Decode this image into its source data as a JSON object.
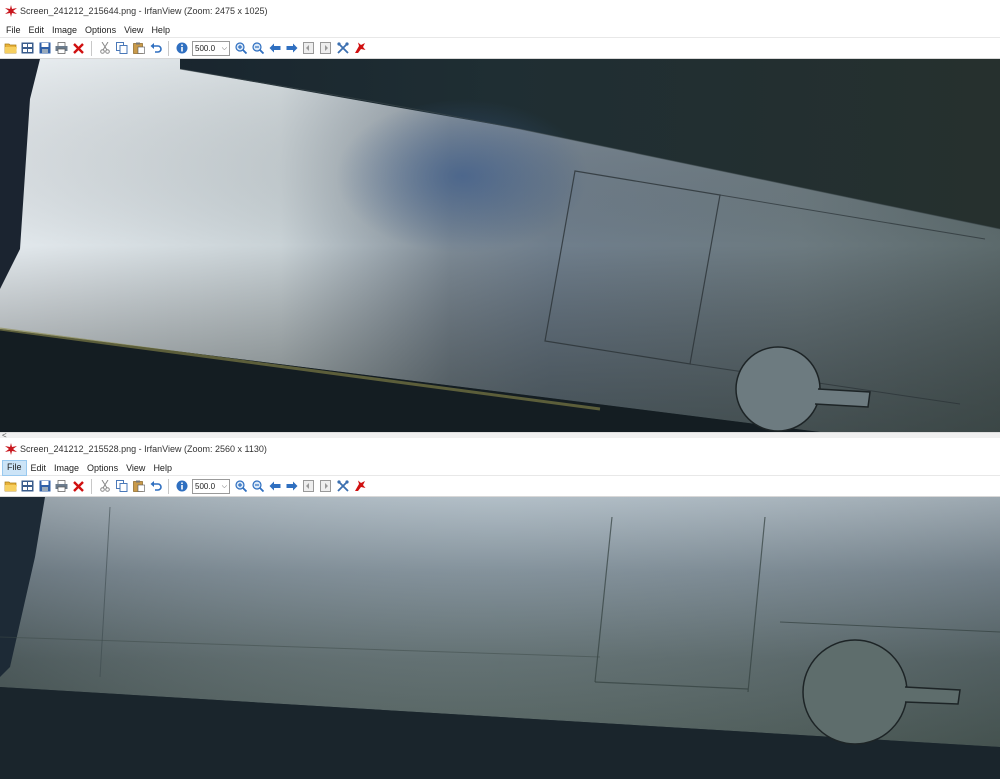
{
  "windows": [
    {
      "title": "Screen_241212_215644.png - IrfanView (Zoom: 2475 x 1025)",
      "menu": [
        "File",
        "Edit",
        "Image",
        "Options",
        "View",
        "Help"
      ],
      "zoom_value": "500.0",
      "scroll_arrow": "<"
    },
    {
      "title": "Screen_241212_215528.png - IrfanView (Zoom: 2560 x 1130)",
      "menu": [
        "File",
        "Edit",
        "Image",
        "Options",
        "View",
        "Help"
      ],
      "zoom_value": "500.0",
      "active_menu": "File"
    }
  ],
  "toolbar_icons": [
    "open-folder-icon",
    "thumbnails-icon",
    "save-icon",
    "print-icon",
    "delete-icon",
    "cut-icon",
    "copy-icon",
    "paste-icon",
    "undo-icon",
    "info-icon",
    "zoom-in-icon",
    "zoom-out-icon",
    "previous-icon",
    "next-icon",
    "first-page-icon",
    "last-page-icon",
    "settings-icon",
    "exit-icon"
  ],
  "colors": {
    "accent_red": "#d01010",
    "icon_blue": "#2f6fc0",
    "menu_highlight": "#cce4f7"
  }
}
